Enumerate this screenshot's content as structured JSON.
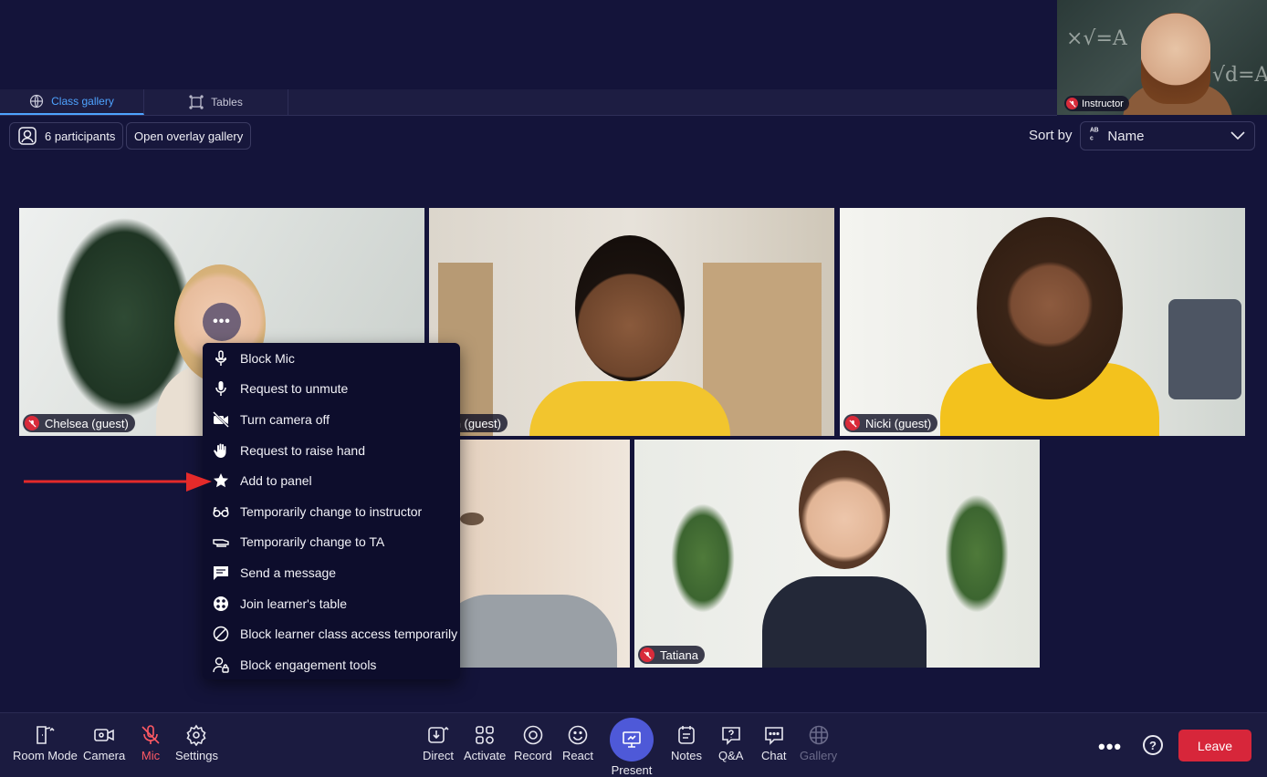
{
  "instructor": {
    "label": "Instructor"
  },
  "tabs": [
    {
      "label": "Class gallery",
      "active": true,
      "icon": "globe-icon"
    },
    {
      "label": "Tables",
      "active": false,
      "icon": "tables-icon"
    }
  ],
  "toolbar_top": {
    "participants": "6 participants",
    "overlay": "Open overlay gallery",
    "sort_label": "Sort by",
    "sort_value": "Name"
  },
  "participants": [
    {
      "name": "Chelsea (guest)",
      "mic_muted": true
    },
    {
      "name": "aden (guest)",
      "mic_muted": false
    },
    {
      "name": "Nicki (guest)",
      "mic_muted": true
    },
    {
      "name": "",
      "mic_muted": false
    },
    {
      "name": "Tatiana",
      "mic_muted": true
    }
  ],
  "context_menu": {
    "items": [
      {
        "label": "Block Mic",
        "icon": "mic-block-icon"
      },
      {
        "label": "Request to unmute",
        "icon": "mic-icon"
      },
      {
        "label": "Turn camera off",
        "icon": "camera-off-icon"
      },
      {
        "label": "Request to raise hand",
        "icon": "hand-icon"
      },
      {
        "label": "Add to panel",
        "icon": "star-icon"
      },
      {
        "label": "Temporarily change to instructor",
        "icon": "glasses-icon"
      },
      {
        "label": "Temporarily change to TA",
        "icon": "hat-icon"
      },
      {
        "label": "Send a message",
        "icon": "message-icon"
      },
      {
        "label": "Join learner's table",
        "icon": "table-icon"
      },
      {
        "label": "Block learner class access temporarily",
        "icon": "block-icon"
      },
      {
        "label": "Block engagement tools",
        "icon": "user-lock-icon"
      }
    ]
  },
  "bottom_toolbar": {
    "room_mode": "Room Mode",
    "camera": "Camera",
    "mic": "Mic",
    "settings": "Settings",
    "direct": "Direct",
    "activate": "Activate",
    "record": "Record",
    "react": "React",
    "present": "Present",
    "notes": "Notes",
    "qa": "Q&A",
    "chat": "Chat",
    "gallery": "Gallery",
    "help": "?",
    "leave": "Leave"
  },
  "colors": {
    "background": "#14143a",
    "accent": "#4ea3ff",
    "leave": "#d7263a",
    "present": "#4e59d8",
    "mute": "#d92b3a"
  }
}
